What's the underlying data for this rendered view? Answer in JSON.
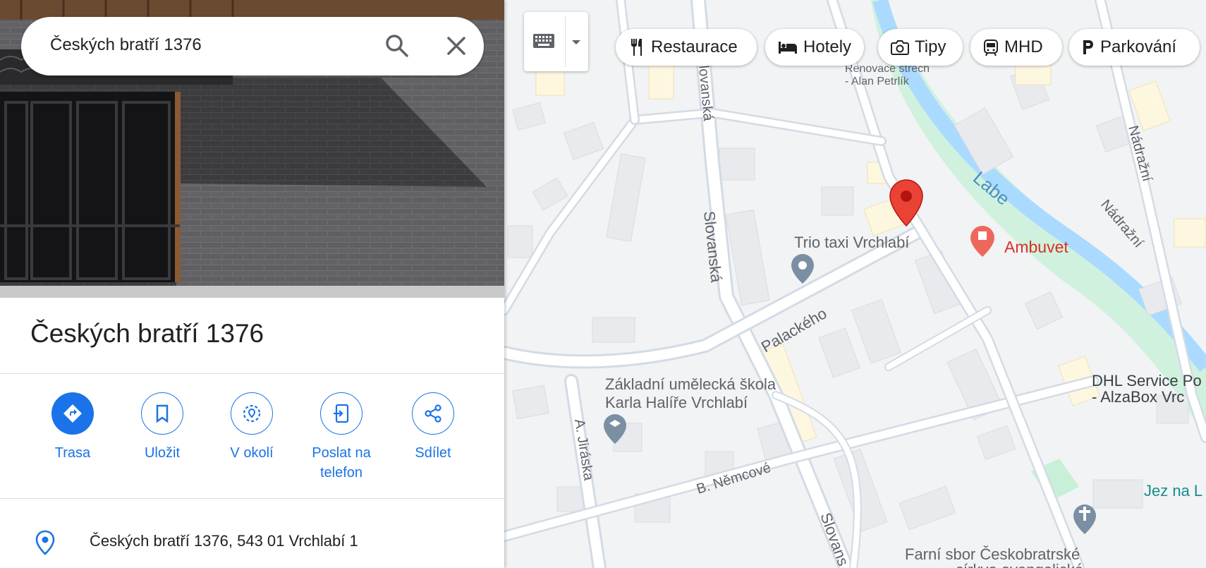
{
  "search": {
    "query": "Českých bratří 1376"
  },
  "place": {
    "title": "Českých bratří 1376",
    "address": "Českých bratří 1376, 543 01 Vrchlabí 1"
  },
  "actions": [
    {
      "label_line1": "Trasa",
      "label_line2": "",
      "icon": "directions-icon"
    },
    {
      "label_line1": "Uložit",
      "label_line2": "",
      "icon": "bookmark-icon"
    },
    {
      "label_line1": "V okolí",
      "label_line2": "",
      "icon": "nearby-icon"
    },
    {
      "label_line1": "Poslat na",
      "label_line2": "telefon",
      "icon": "send-to-phone-icon"
    },
    {
      "label_line1": "Sdílet",
      "label_line2": "",
      "icon": "share-icon"
    }
  ],
  "chips": [
    {
      "label": "Restaurace",
      "icon": "fork-knife-icon"
    },
    {
      "label": "Hotely",
      "icon": "bed-icon"
    },
    {
      "label": "Tipy",
      "icon": "camera-icon"
    },
    {
      "label": "MHD",
      "icon": "tram-icon"
    },
    {
      "label": "Parkování",
      "icon": "parking-icon"
    }
  ],
  "map": {
    "streets": [
      "Slovanská",
      "Slovanská",
      "Palackého",
      "A. Jiráska",
      "B. Němcové",
      "Nádražní",
      "Nádražní",
      "Slovans",
      "Labe"
    ],
    "pois": {
      "trio": "Trio taxi Vrchlabí",
      "ambuvet": "Ambuvet",
      "school_line1": "Základní umělecká škola",
      "school_line2": "Karla Halíře Vrchlabí",
      "dhl_line1": "DHL Service Po",
      "dhl_line2": "- AlzaBox Vrc",
      "jez": "Jez na L",
      "farni_line1": "Farní sbor Českobratrské",
      "farni_line2": "církve evangelické",
      "renovace_line1": "Renovace střech",
      "renovace_line2": "- Alan Petrlík"
    }
  },
  "colors": {
    "accent": "#1a73e8",
    "pin": "#ea4335",
    "water": "#aadaff",
    "park": "#c8f0d8"
  }
}
